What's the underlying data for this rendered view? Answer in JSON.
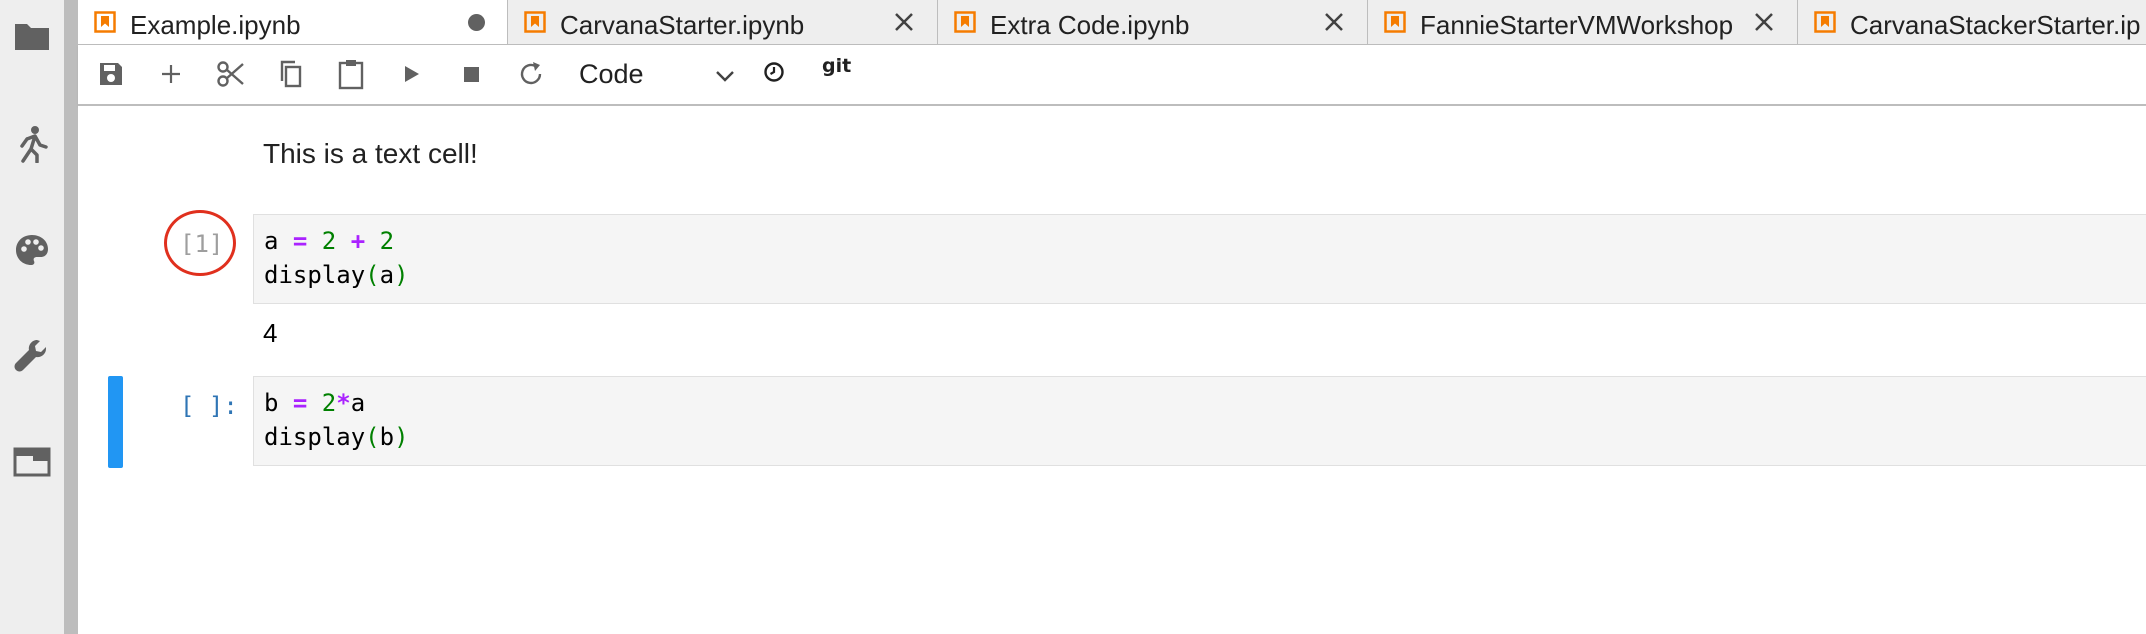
{
  "activity_bar": {
    "icons": [
      "folder-icon",
      "running-icon",
      "palette-icon",
      "wrench-icon",
      "tabs-icon"
    ]
  },
  "tabs": [
    {
      "label": "Example.ipynb",
      "active": true,
      "dirty": true
    },
    {
      "label": "CarvanaStarter.ipynb",
      "active": false,
      "dirty": false
    },
    {
      "label": "Extra Code.ipynb",
      "active": false,
      "dirty": false
    },
    {
      "label": "FannieStarterVMWorkshop",
      "active": false,
      "dirty": false
    },
    {
      "label": "CarvanaStackerStarter.ip",
      "active": false,
      "dirty": false
    }
  ],
  "toolbar": {
    "icons": [
      "save-icon",
      "plus-icon",
      "scissors-icon",
      "copy-icon",
      "paste-icon",
      "run-icon",
      "stop-icon",
      "restart-icon"
    ],
    "cell_type": "Code",
    "clock_icon": "clock-icon",
    "git_label": "git"
  },
  "notebook": {
    "markdown_text": "This is a text cell!",
    "cell1": {
      "prompt": "[1]",
      "line1": {
        "a": "a ",
        "eq": "=",
        "n1": " 2 ",
        "plus": "+",
        "n2": " 2"
      },
      "line2": {
        "fn": "display",
        "lp": "(",
        "arg": "a",
        "rp": ")"
      },
      "output": "4"
    },
    "cell2": {
      "prompt": "[ ]:",
      "line1": {
        "b": "b ",
        "eq": "=",
        "n": " 2",
        "star": "*",
        "a": "a"
      },
      "line2": {
        "fn": "display",
        "lp": "(",
        "arg": "b",
        "rp": ")"
      }
    }
  },
  "colors": {
    "accent_orange": "#f57c00",
    "active_cell_blue": "#2196f3",
    "annotation_red": "#e0301e"
  }
}
